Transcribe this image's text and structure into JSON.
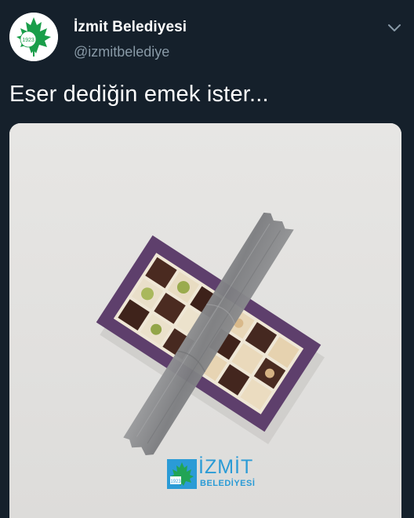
{
  "account": {
    "display_name": "İzmit Belediyesi",
    "handle": "@izmitbelediye",
    "avatar_year": "1923",
    "brand_color": "#1a9e4a"
  },
  "tweet": {
    "text": "Eser dediğin emek ister..."
  },
  "media": {
    "logo_name": "İZMİT",
    "logo_sub": "BELEDİYESİ",
    "logo_year": "1923",
    "box_color": "#5e3f6c",
    "tape_color": "#8c8d8f",
    "logo_color": "#2a9bd6"
  },
  "icons": {
    "menu": "chevron-down-icon",
    "avatar_leaf": "maple-leaf-icon"
  }
}
